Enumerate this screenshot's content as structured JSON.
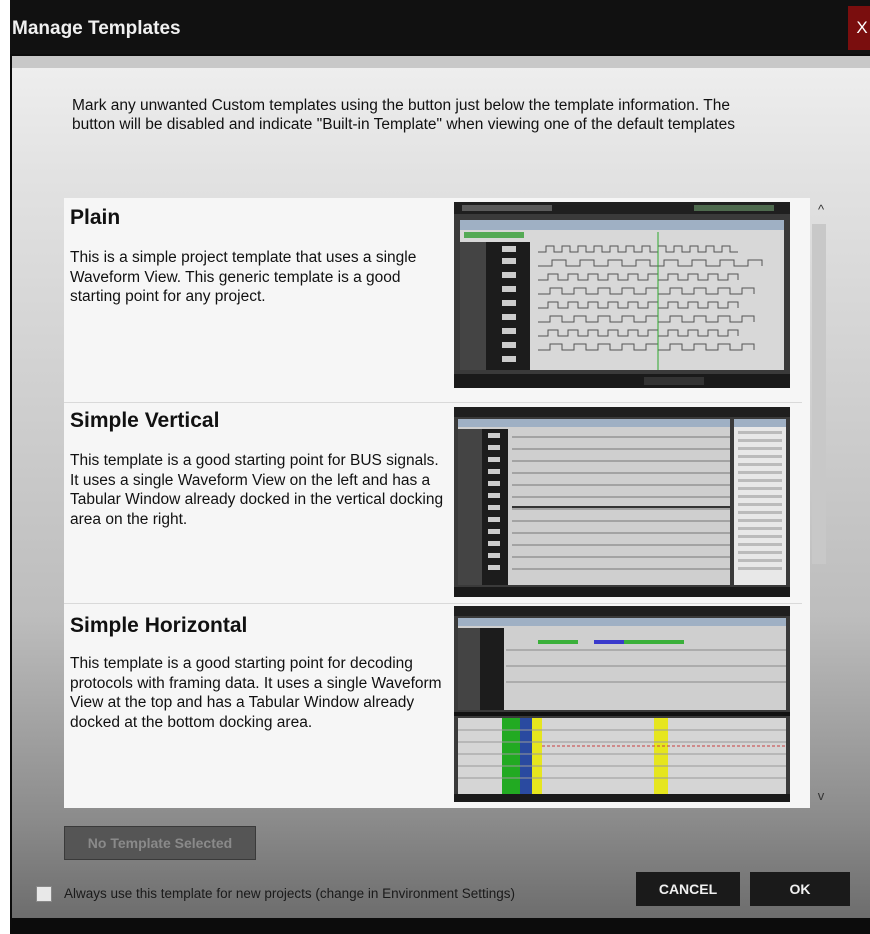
{
  "dialog": {
    "title": "Manage Templates",
    "close_label": "X"
  },
  "instructions": "Mark any unwanted Custom templates using the button just below the template information. The button will be disabled and indicate \"Built-in Template\" when viewing one of the default templates",
  "templates": [
    {
      "title": "Plain",
      "description": "This is a simple project template that uses a single Waveform View. This generic template is a good starting point for any project."
    },
    {
      "title": "Simple Vertical",
      "description": "This template is a good starting point for BUS signals. It uses a single Waveform View on the left and has a Tabular Window already docked in the vertical docking area on the right."
    },
    {
      "title": "Simple Horizontal",
      "description": "This template is a good starting point for decoding protocols with framing data. It uses a single Waveform View at the top and has a Tabular Window already docked at the bottom docking area."
    }
  ],
  "scroll": {
    "up_icon": "^",
    "down_icon": "v"
  },
  "no_template_button": "No Template Selected",
  "always_use_checkbox": {
    "label": "Always use this template for new projects (change in Environment Settings)",
    "checked": false
  },
  "cancel_button": "CANCEL",
  "ok_button": "OK",
  "colors": {
    "close_button": "#7a0e0e",
    "title_bar": "#111111",
    "buttons": "#1a1a1a"
  }
}
